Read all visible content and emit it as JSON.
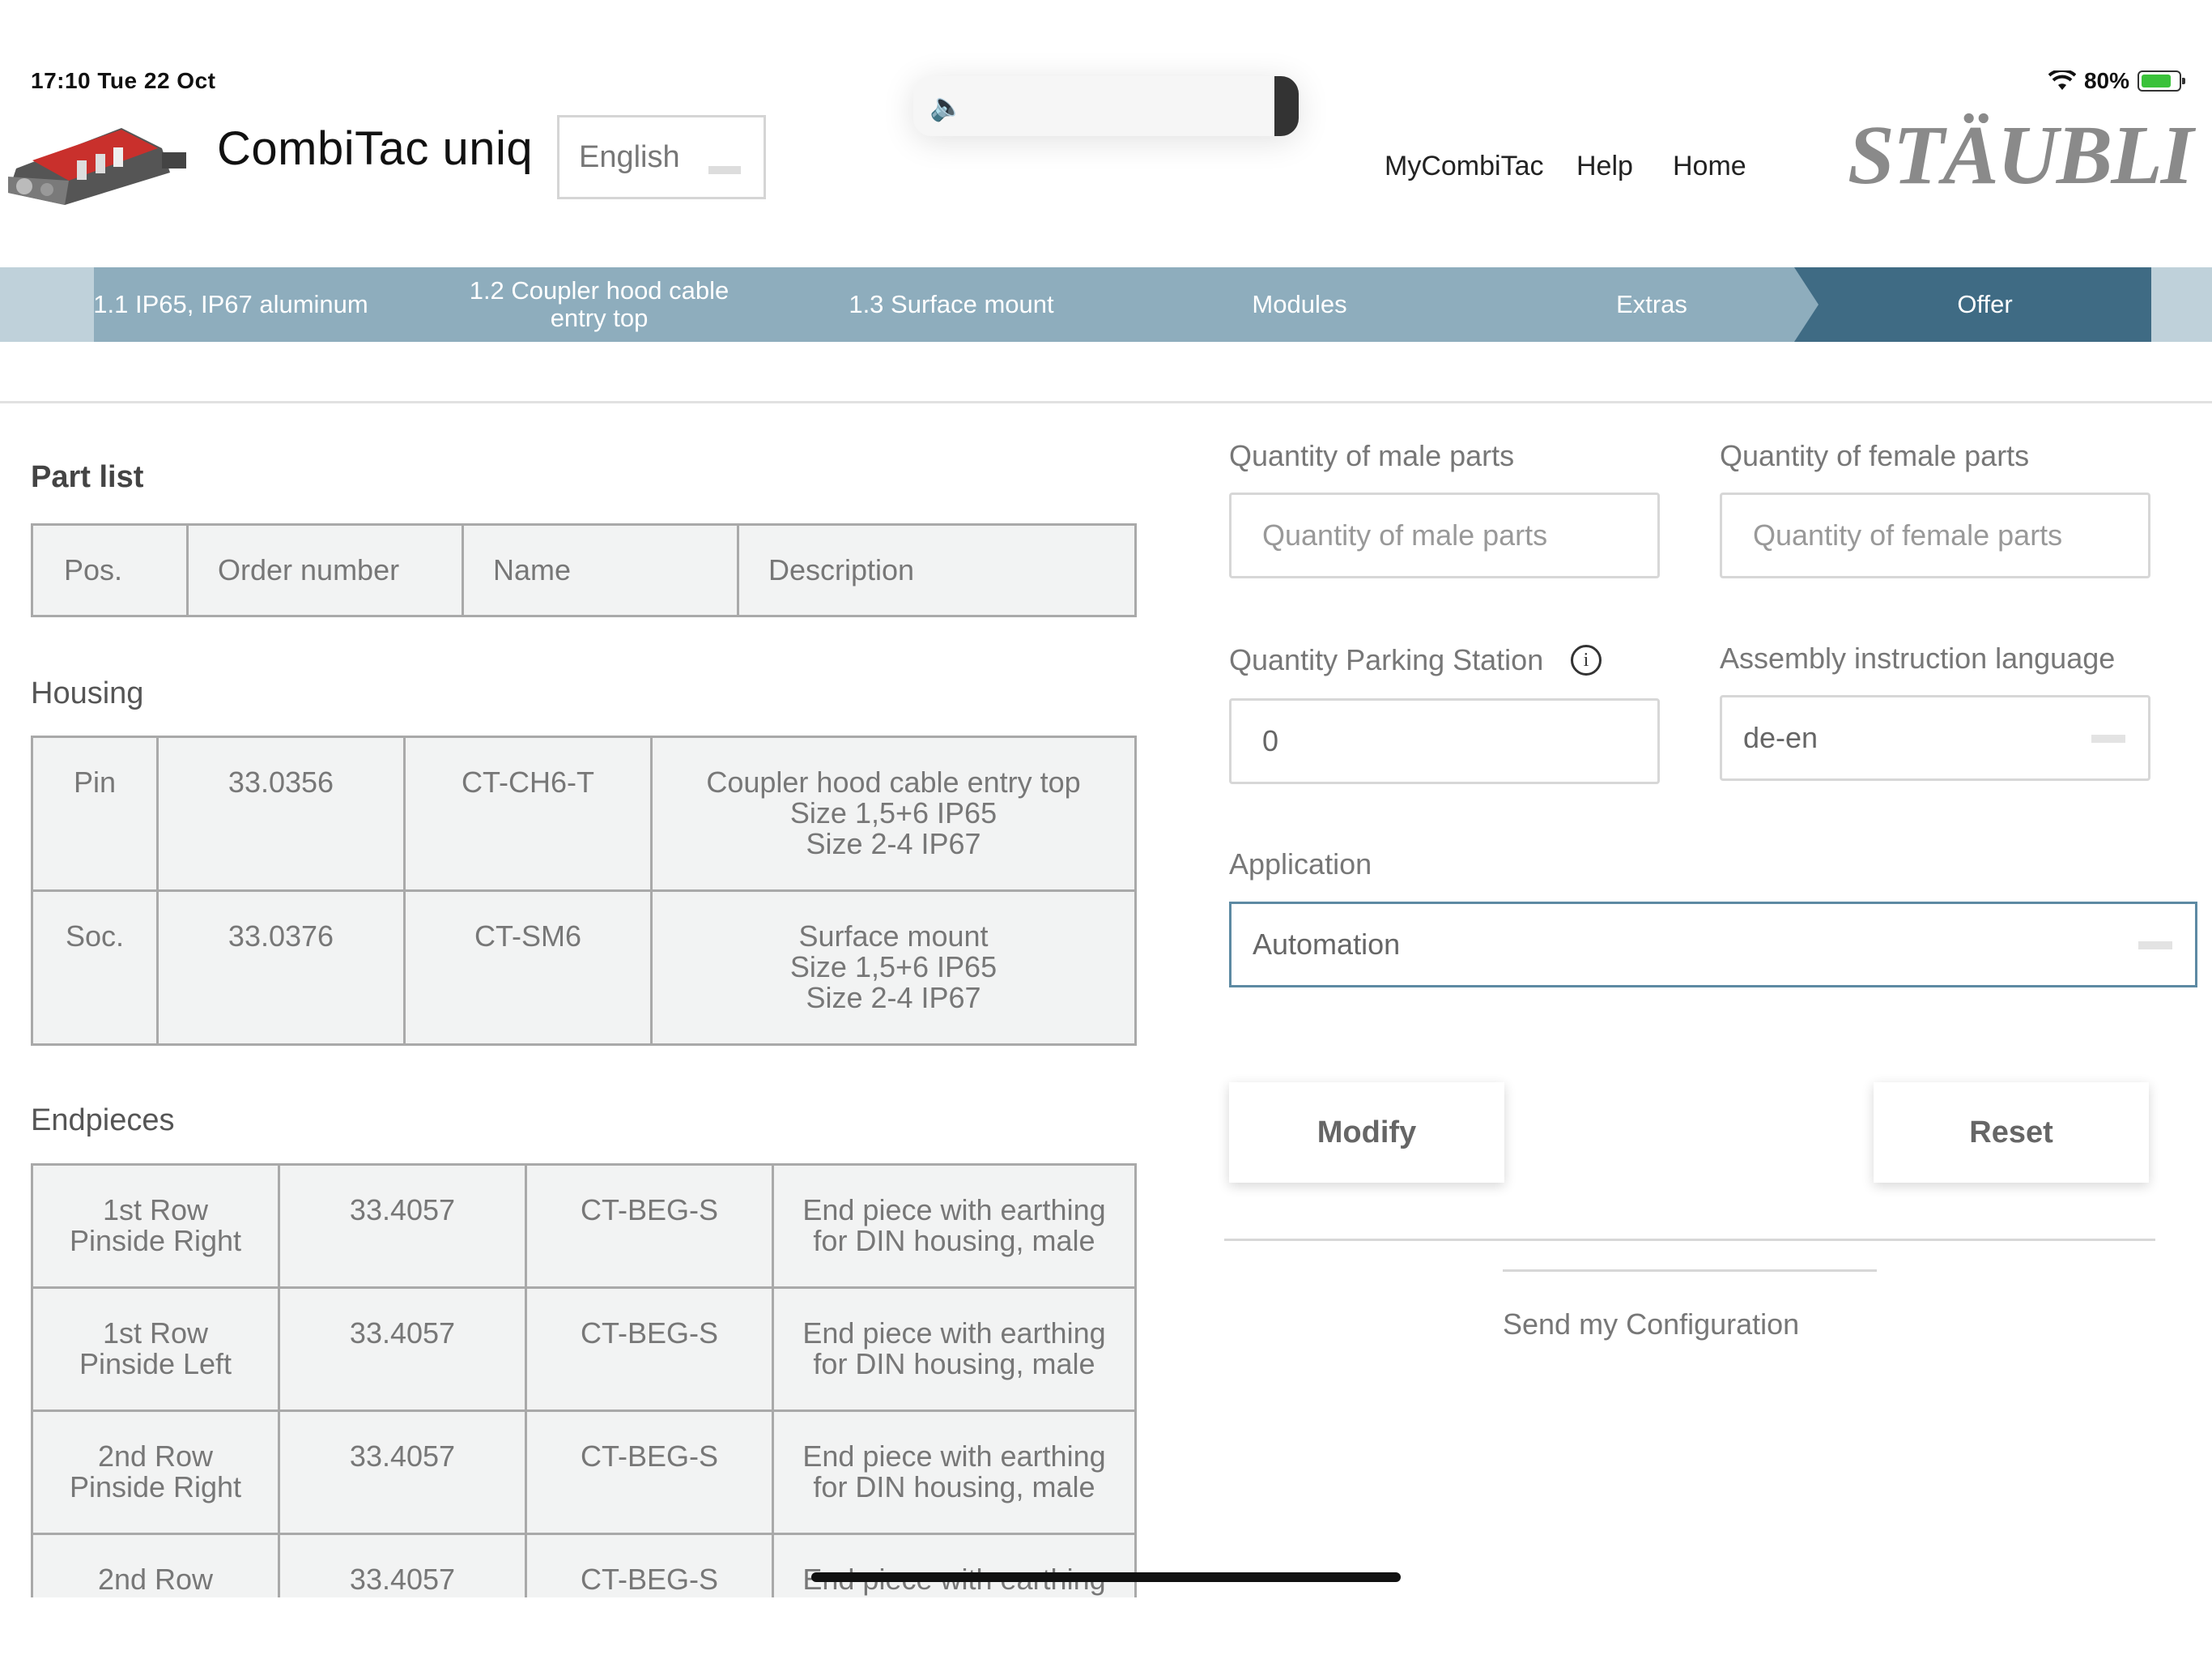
{
  "status": {
    "time": "17:10  Tue 22 Oct",
    "battery_percent": "80%",
    "battery_level": 0.8
  },
  "header": {
    "app_title": "CombiTac uniq",
    "language": "English",
    "nav": [
      "MyCombiTac",
      "Help",
      "Home"
    ],
    "brand": "STÄUBLI"
  },
  "steps": [
    {
      "label": "1.1 IP65, IP67 aluminum"
    },
    {
      "label": "1.2 Coupler hood cable entry top"
    },
    {
      "label": "1.3 Surface mount"
    },
    {
      "label": "Modules"
    },
    {
      "label": "Extras"
    },
    {
      "label": "Offer",
      "active": true
    }
  ],
  "part_list": {
    "title": "Part list",
    "headers": [
      "Pos.",
      "Order number",
      "Name",
      "Description"
    ],
    "housing": {
      "title": "Housing",
      "rows": [
        {
          "pos": "Pin",
          "order": "33.0356",
          "name": "CT-CH6-T",
          "desc": [
            "Coupler hood cable entry top",
            "Size 1,5+6 IP65",
            "Size 2-4 IP67"
          ]
        },
        {
          "pos": "Soc.",
          "order": "33.0376",
          "name": "CT-SM6",
          "desc": [
            "Surface mount",
            "Size 1,5+6 IP65",
            "Size 2-4 IP67"
          ]
        }
      ]
    },
    "endpieces": {
      "title": "Endpieces",
      "rows": [
        {
          "pos": [
            "1st Row",
            "Pinside Right"
          ],
          "order": "33.4057",
          "name": "CT-BEG-S",
          "desc": [
            "End piece with earthing",
            "for DIN housing, male"
          ]
        },
        {
          "pos": [
            "1st Row",
            "Pinside Left"
          ],
          "order": "33.4057",
          "name": "CT-BEG-S",
          "desc": [
            "End piece with earthing",
            "for DIN housing, male"
          ]
        },
        {
          "pos": [
            "2nd Row",
            "Pinside Right"
          ],
          "order": "33.4057",
          "name": "CT-BEG-S",
          "desc": [
            "End piece with earthing",
            "for DIN housing, male"
          ]
        },
        {
          "pos": [
            "2nd Row",
            ""
          ],
          "order": "33.4057",
          "name": "CT-BEG-S",
          "desc": [
            "End piece with earthing",
            ""
          ]
        }
      ]
    }
  },
  "form": {
    "male_label": "Quantity of male parts",
    "male_placeholder": "Quantity of male parts",
    "female_label": "Quantity of female parts",
    "female_placeholder": "Quantity of female parts",
    "parking_label": "Quantity Parking Station",
    "parking_value": "0",
    "assembly_label": "Assembly instruction language",
    "assembly_value": "de-en",
    "application_label": "Application",
    "application_value": "Automation",
    "modify": "Modify",
    "reset": "Reset",
    "send": "Send my Configuration"
  }
}
